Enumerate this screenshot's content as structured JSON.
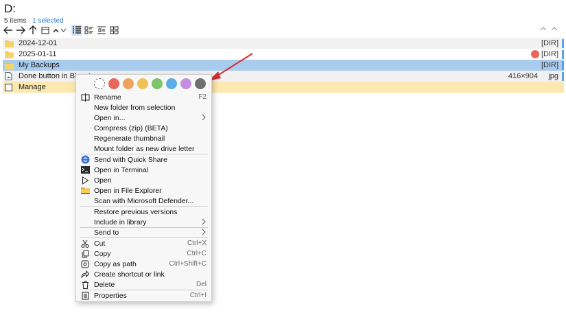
{
  "path": "D:",
  "status": {
    "items": "5 items",
    "selected": "1 selected"
  },
  "rows": [
    {
      "name": "2024-12-01",
      "tag": "[DIR]",
      "icon": "folder-icon"
    },
    {
      "name": "2025-01-11",
      "tag": "[DIR]",
      "icon": "folder-icon",
      "color_label": "#e8665a"
    },
    {
      "name": "My Backups",
      "tag": "[DIR]",
      "icon": "folder-icon"
    },
    {
      "name": "Done button in Bluest",
      "dims": "416×904",
      "tag": "jpg",
      "icon": "image-file-icon"
    },
    {
      "name": "Manage",
      "icon": "checkbox-icon"
    }
  ],
  "colors": [
    "#e8665a",
    "#eda260",
    "#eec257",
    "#7dc46a",
    "#5aaee8",
    "#c38ee0",
    "#6f6f6f"
  ],
  "menu": {
    "rename": {
      "label": "Rename",
      "shortcut": "F2"
    },
    "new_folder": {
      "label": "New folder from selection"
    },
    "open_in": {
      "label": "Open in..."
    },
    "compress": {
      "label": "Compress (zip) (BETA)"
    },
    "regen": {
      "label": "Regenerate thumbnail"
    },
    "mount": {
      "label": "Mount folder as new drive letter"
    },
    "quick_share": {
      "label": "Send with Quick Share"
    },
    "terminal": {
      "label": "Open in Terminal"
    },
    "open": {
      "label": "Open"
    },
    "explorer": {
      "label": "Open in File Explorer"
    },
    "defender": {
      "label": "Scan with Microsoft Defender..."
    },
    "restore": {
      "label": "Restore previous versions"
    },
    "library": {
      "label": "Include in library"
    },
    "send_to": {
      "label": "Send to"
    },
    "cut": {
      "label": "Cut",
      "shortcut": "Ctrl+X"
    },
    "copy": {
      "label": "Copy",
      "shortcut": "Ctrl+C"
    },
    "copy_path": {
      "label": "Copy as path",
      "shortcut": "Ctrl+Shift+C"
    },
    "shortcut": {
      "label": "Create shortcut or link"
    },
    "delete": {
      "label": "Delete",
      "shortcut": "Del"
    },
    "properties": {
      "label": "Properties",
      "shortcut": "Ctrl+I"
    }
  },
  "annotation_color": "#d22f2f"
}
